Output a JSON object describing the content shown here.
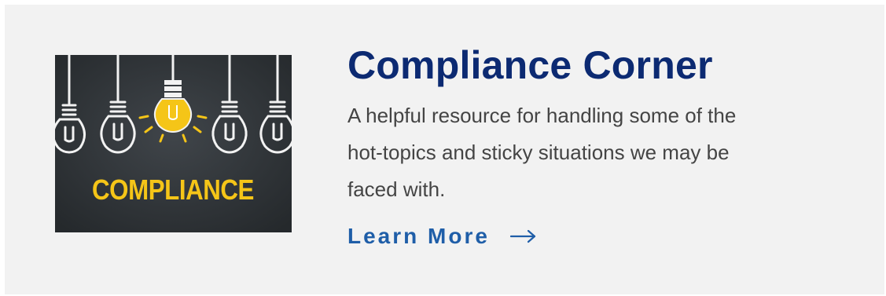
{
  "card": {
    "title": "Compliance Corner",
    "description": "A helpful resource for handling some of the hot-topics and sticky situations we may be faced with.",
    "link_label": "Learn More"
  },
  "image": {
    "caption": "COMPLIANCE",
    "icon": "light-bulbs-icon"
  },
  "colors": {
    "title": "#0c2a72",
    "link": "#1f5ea8",
    "text": "#444444",
    "card_background": "#f2f2f2",
    "chalkboard": "#2f3336",
    "accent_yellow": "#f5c518"
  },
  "icons": {
    "link_arrow": "arrow-right-icon"
  }
}
